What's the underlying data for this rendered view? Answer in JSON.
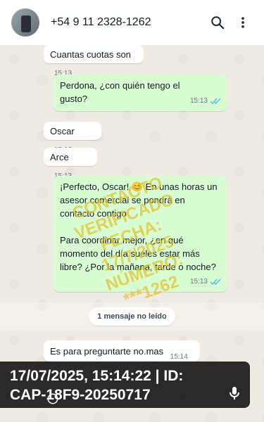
{
  "header": {
    "contact_name": "+54 9 11 2328-1262",
    "icons": [
      "avatar",
      "search-icon",
      "more-vertical-icon"
    ]
  },
  "messages": [
    {
      "dir": "in",
      "text": "Cuantas cuotas son",
      "time": "15:13"
    },
    {
      "dir": "out",
      "text": "Perdona, ¿con quién tengo el gusto?",
      "time": "15:13",
      "status": "read"
    },
    {
      "dir": "in",
      "text": "Oscar",
      "time": "15:13"
    },
    {
      "dir": "in",
      "text": "Arce",
      "time": "15:13"
    },
    {
      "dir": "out",
      "text_p1": "¡Perfecto, Oscar! 😊 En unas horas un asesor comercial se pondrá en contacto contigo",
      "text_p2": "Para coordinar mejor, ¿en qué momento del día sueles estar más libre? ¿Por la mañana, tarde o noche?",
      "time": "15:13",
      "status": "read"
    },
    {
      "dir": "in",
      "text": "Es para preguntarte no.mas",
      "time": "15:14"
    }
  ],
  "unread_divider": "1 mensaje no leído",
  "watermark": {
    "lines": [
      "CONTACTO",
      "VERIFICADO",
      "FECHA:",
      "17/7/2025",
      "NÚMERO:",
      "***1262"
    ],
    "color": "#e0c12c"
  },
  "stamp": {
    "line1": "17/07/2025, 15:14:22 | ID:",
    "line2": "CAP-18F9-20250717"
  },
  "colors": {
    "chat_bg": "#efeae2",
    "incoming": "#ffffff",
    "outgoing": "#d9fdd3",
    "read_tick": "#53bdeb"
  }
}
